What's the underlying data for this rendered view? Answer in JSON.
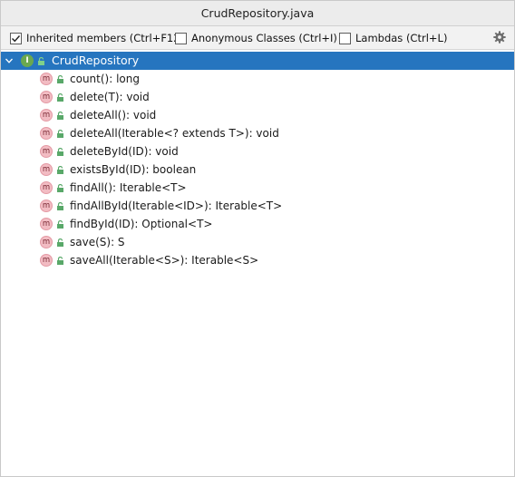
{
  "window": {
    "title": "CrudRepository.java"
  },
  "toolbar": {
    "options": [
      {
        "label": "Inherited members (Ctrl+F12)",
        "checked": true
      },
      {
        "label": "Anonymous Classes (Ctrl+I)",
        "checked": false
      },
      {
        "label": "Lambdas (Ctrl+L)",
        "checked": false
      }
    ],
    "settings_icon": "gear-icon"
  },
  "tree": {
    "root": {
      "label": "CrudRepository",
      "icon": "interface-icon",
      "icon_letter": "I",
      "expanded": true,
      "selected": true
    },
    "members": [
      {
        "label": "count(): long"
      },
      {
        "label": "delete(T): void"
      },
      {
        "label": "deleteAll(): void"
      },
      {
        "label": "deleteAll(Iterable<? extends T>): void"
      },
      {
        "label": "deleteById(ID): void"
      },
      {
        "label": "existsById(ID): boolean"
      },
      {
        "label": "findAll(): Iterable<T>"
      },
      {
        "label": "findAllById(Iterable<ID>): Iterable<T>"
      },
      {
        "label": "findById(ID): Optional<T>"
      },
      {
        "label": "save(S): S"
      },
      {
        "label": "saveAll(Iterable<S>): Iterable<S>"
      }
    ],
    "member_icon_letter": "m"
  },
  "colors": {
    "selection": "#2675bf",
    "interface_icon": "#6aa84f",
    "method_icon": "#f2bcc3",
    "access_lock": "#59a869"
  }
}
